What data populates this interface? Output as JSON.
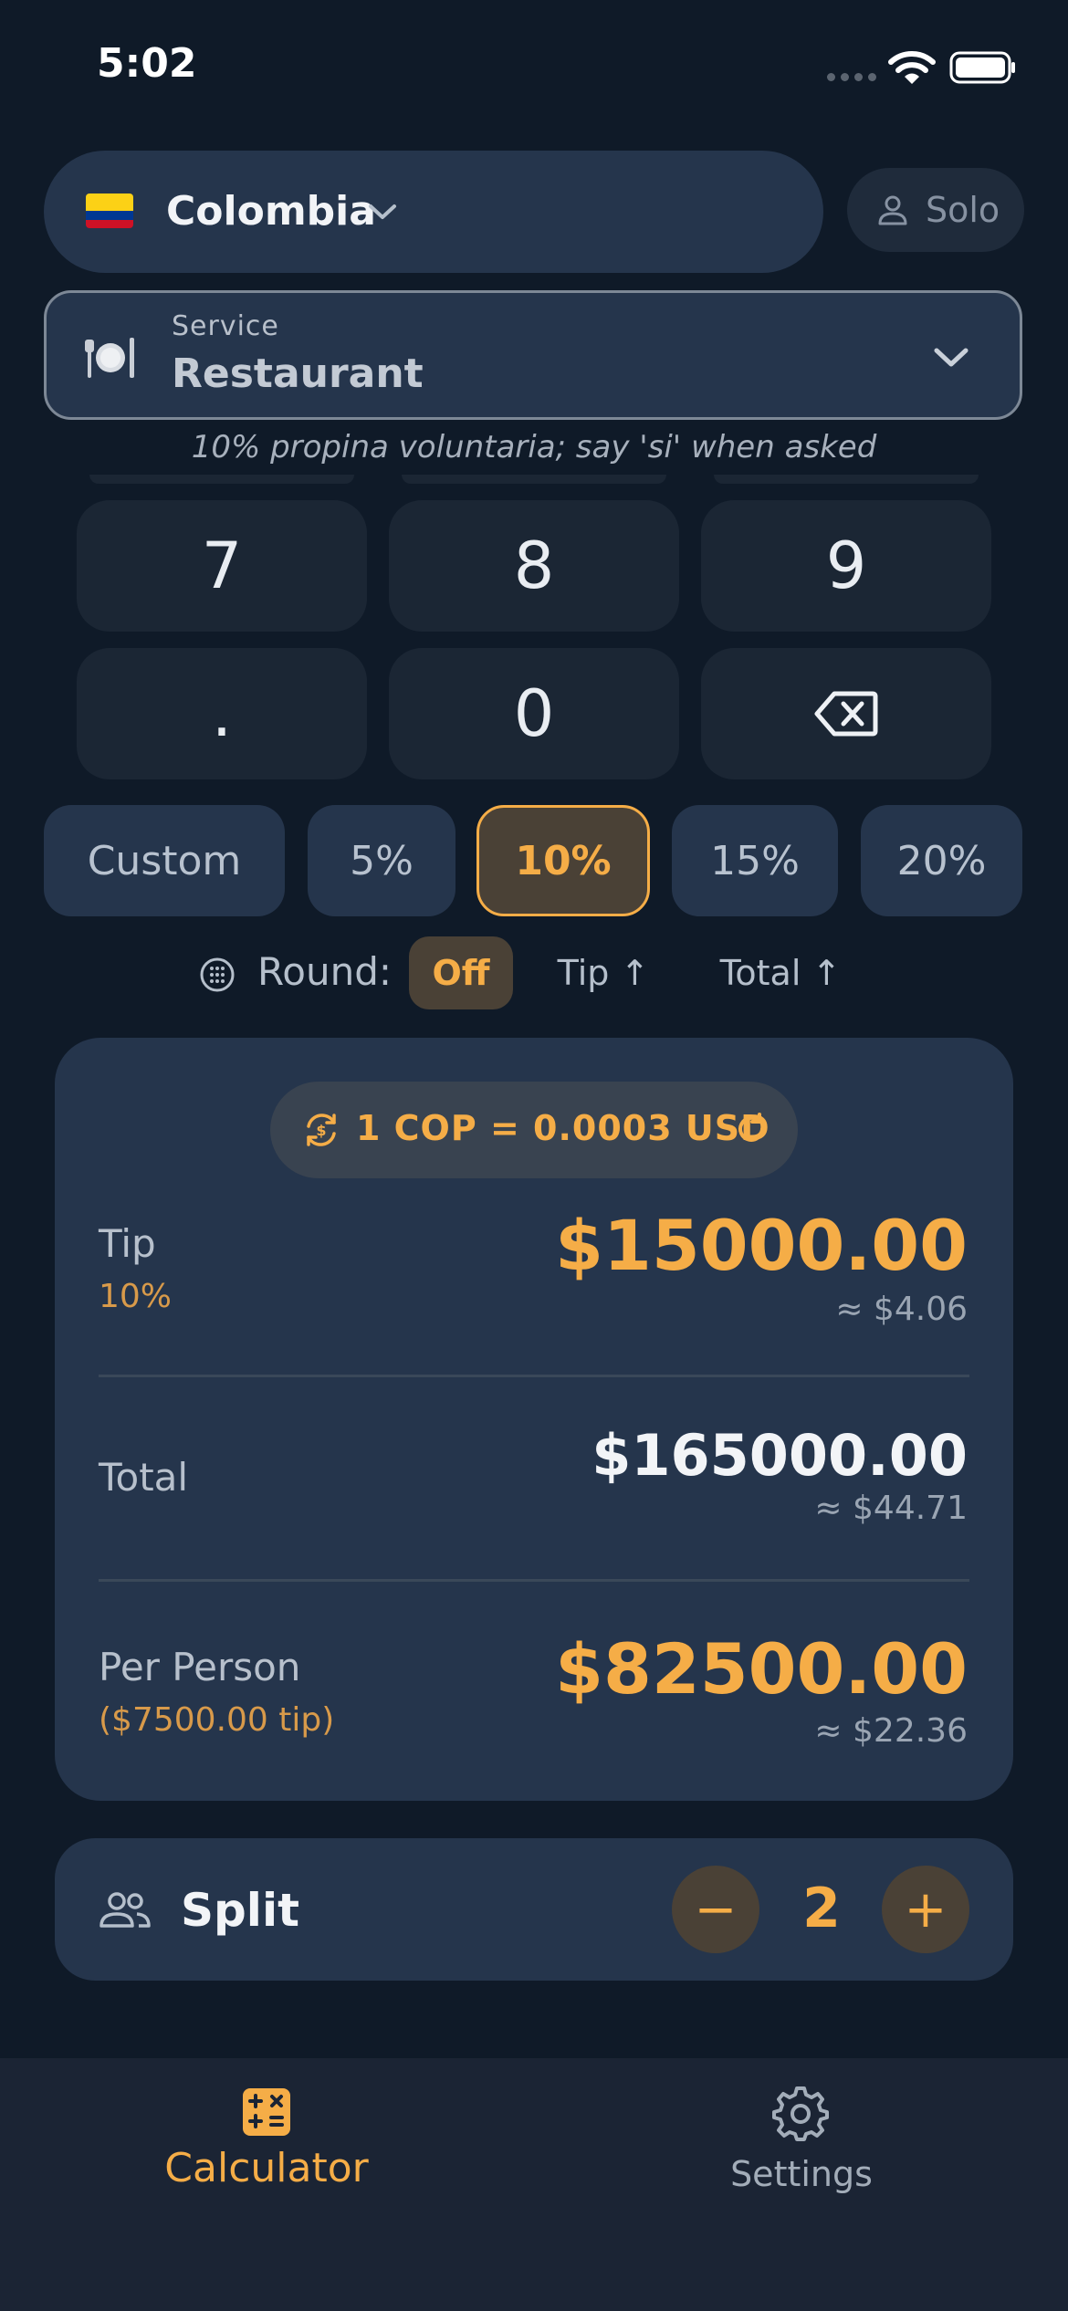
{
  "status": {
    "time": "5:02"
  },
  "country": {
    "name": "Colombia",
    "flag_colors": [
      "#fcd116",
      "#003893",
      "#ce1126"
    ]
  },
  "mode": {
    "label": "Solo"
  },
  "service": {
    "caption": "Service",
    "value": "Restaurant"
  },
  "hint": "10% propina voluntaria; say 'si' when asked",
  "keypad": {
    "keys": [
      "7",
      "8",
      "9",
      ".",
      "0"
    ]
  },
  "tip_options": [
    {
      "label": "Custom",
      "active": false
    },
    {
      "label": "5%",
      "active": false
    },
    {
      "label": "10%",
      "active": true
    },
    {
      "label": "15%",
      "active": false
    },
    {
      "label": "20%",
      "active": false
    }
  ],
  "rounding": {
    "label": "Round:",
    "options": [
      "Off",
      "Tip ↑",
      "Total ↑"
    ],
    "selected": "Off"
  },
  "exchange": {
    "text": "1 COP = 0.0003 USD"
  },
  "results": {
    "tip": {
      "label": "Tip",
      "percent": "10%",
      "amount": "$15000.00",
      "converted": "≈ $4.06"
    },
    "total": {
      "label": "Total",
      "amount": "$165000.00",
      "converted": "≈ $44.71"
    },
    "per_person": {
      "label": "Per Person",
      "tip_note": "($7500.00 tip)",
      "amount": "$82500.00",
      "converted": "≈ $22.36"
    }
  },
  "split": {
    "label": "Split",
    "count": "2",
    "minus": "−",
    "plus": "+"
  },
  "tabs": {
    "calculator": "Calculator",
    "settings": "Settings"
  },
  "colors": {
    "accent": "#f5ad47",
    "card": "#25354c",
    "background": "#0f1a28"
  }
}
